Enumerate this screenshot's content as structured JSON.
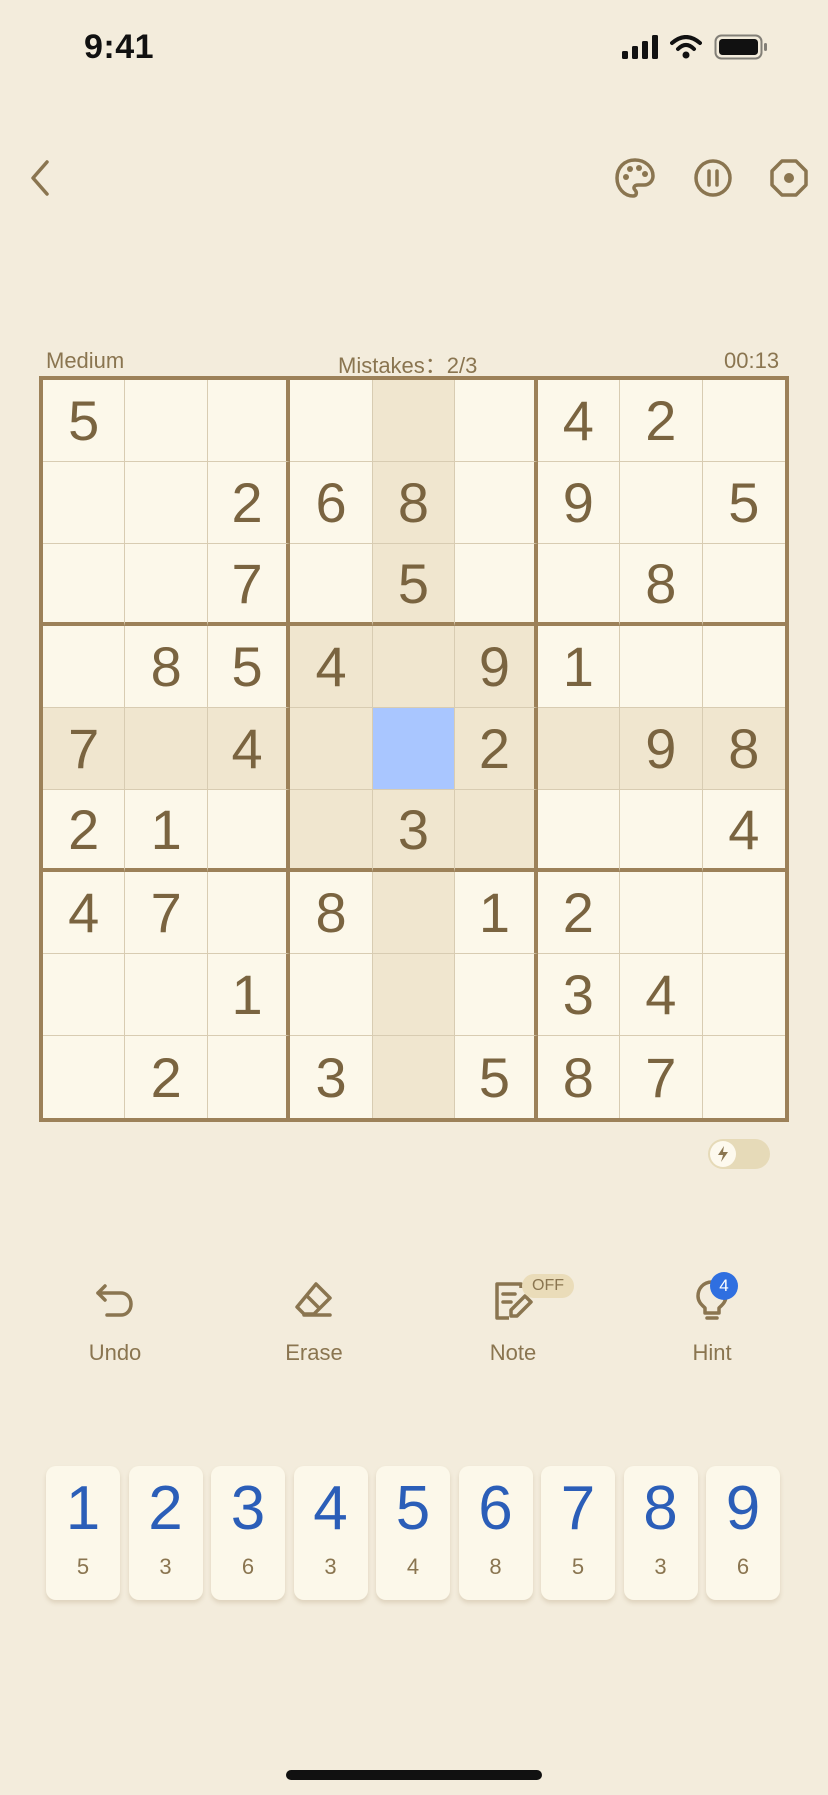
{
  "status_bar": {
    "time": "9:41",
    "icons": [
      "signal-icon",
      "wifi-icon",
      "battery-icon"
    ]
  },
  "nav": {
    "back_icon": "chevron-left-icon",
    "theme_icon": "palette-icon",
    "pause_icon": "pause-icon",
    "settings_icon": "settings-icon"
  },
  "game": {
    "difficulty": "Medium",
    "mistakes_label": "Mistakes：2/3",
    "timer": "00:13"
  },
  "board": {
    "rows": [
      [
        "5",
        "",
        "",
        "",
        "",
        "",
        "4",
        "2",
        ""
      ],
      [
        "",
        "",
        "2",
        "6",
        "8",
        "",
        "9",
        "",
        "5"
      ],
      [
        "",
        "",
        "7",
        "",
        "5",
        "",
        "",
        "8",
        ""
      ],
      [
        "",
        "8",
        "5",
        "4",
        "",
        "9",
        "1",
        "",
        ""
      ],
      [
        "7",
        "",
        "4",
        "",
        "",
        "2",
        "",
        "9",
        "8"
      ],
      [
        "2",
        "1",
        "",
        "",
        "3",
        "",
        "",
        "",
        "4"
      ],
      [
        "4",
        "7",
        "",
        "8",
        "",
        "1",
        "2",
        "",
        ""
      ],
      [
        "",
        "",
        "1",
        "",
        "",
        "",
        "3",
        "4",
        ""
      ],
      [
        "",
        "2",
        "",
        "3",
        "",
        "5",
        "8",
        "7",
        ""
      ]
    ],
    "selected_cell": {
      "row": 4,
      "col": 4
    }
  },
  "tools": {
    "undo": "Undo",
    "erase": "Erase",
    "note": "Note",
    "note_status": "OFF",
    "hint": "Hint",
    "hint_count": "4"
  },
  "numpad": [
    {
      "digit": "1",
      "count": "5"
    },
    {
      "digit": "2",
      "count": "3"
    },
    {
      "digit": "3",
      "count": "6"
    },
    {
      "digit": "4",
      "count": "3"
    },
    {
      "digit": "5",
      "count": "4"
    },
    {
      "digit": "6",
      "count": "8"
    },
    {
      "digit": "7",
      "count": "5"
    },
    {
      "digit": "8",
      "count": "3"
    },
    {
      "digit": "9",
      "count": "6"
    }
  ],
  "colors": {
    "background": "#f3ecdc",
    "board_border": "#9c8159",
    "highlight": "#f0e6cf",
    "selected": "#a9c6ff",
    "digit_blue": "#2b5eb8"
  }
}
